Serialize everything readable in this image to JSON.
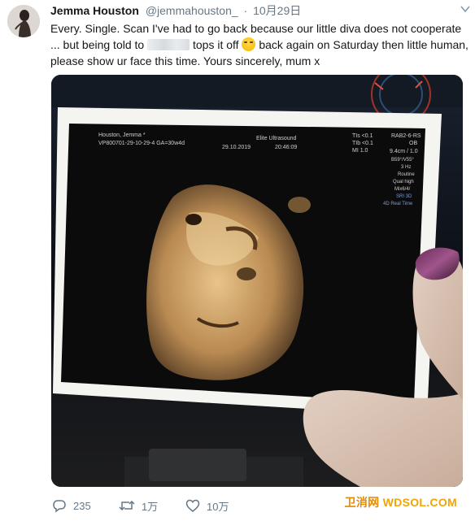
{
  "tweet": {
    "display_name": "Jemma Houston",
    "handle": "@jemmahouston_",
    "separator": "·",
    "date": "10月29日",
    "text_part1": "Every. Single. Scan I've had to go back because our little diva does not cooperate ... but being told to",
    "text_part2": "tops it off",
    "text_part3": "back again on Saturday then little human, please show ur face this time.  Yours sincerely, mum x",
    "media_alt": "ultrasound photo",
    "scan_text": {
      "patient": "Houston, Jemma *",
      "id": "VP800701-29-10-29-4  GA=30w4d",
      "machine": "Elite Ultrasound",
      "date": "29.10.2019",
      "time": "20:46:09",
      "tis": "TIs <0.1",
      "tib": "TIb <0.1",
      "mi": "MI  1.0",
      "probe": "RAB2-6-RS",
      "ob": "OB",
      "depth": "9.4cm / 1.0",
      "angle": "B59°/V55°",
      "hz": "3 Hz",
      "routine": "Routine",
      "qual": "Qual high",
      "mix": "Mix6/4/",
      "sri": "SRI 3D",
      "realtime": "4D Real Time"
    }
  },
  "actions": {
    "reply_count": "235",
    "retweet_count": "1万",
    "like_count": "10万"
  },
  "watermark": {
    "cn": "卫消网",
    "en": "WDSOL.COM"
  },
  "colors": {
    "text": "#14171a",
    "secondary": "#657786",
    "watermark": "#f0a500"
  }
}
